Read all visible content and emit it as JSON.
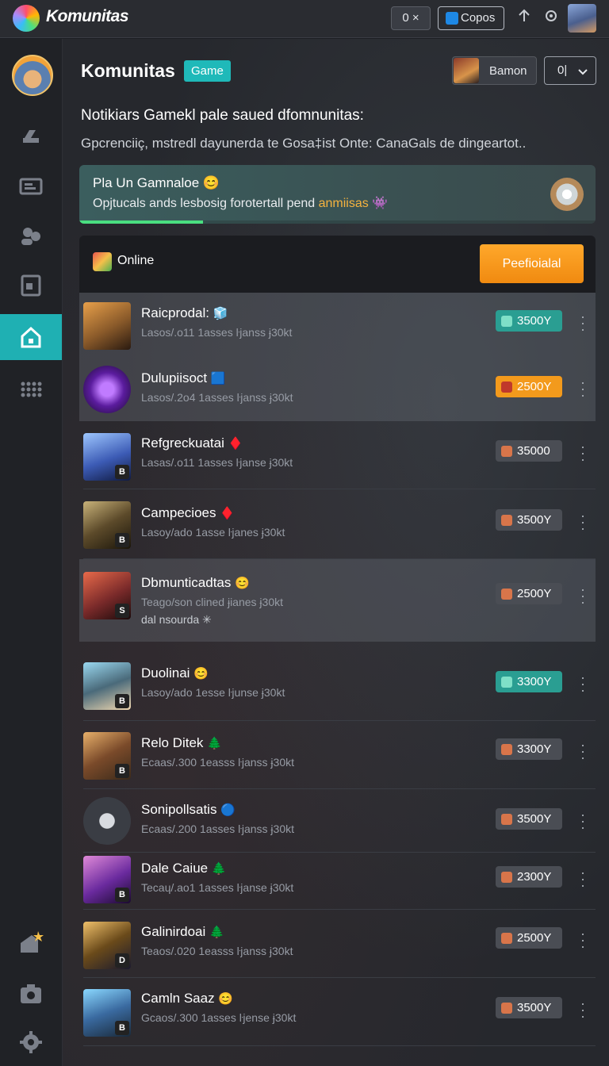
{
  "app": {
    "title": "Komunitas"
  },
  "topbar": {
    "counter_label": "0 ×",
    "copos_label": "Copos",
    "icons": [
      "logo-orb-icon",
      "copos-icon",
      "upload-icon",
      "settings-icon"
    ]
  },
  "sidebar": {
    "items": [
      {
        "icon": "tools-icon"
      },
      {
        "icon": "cards-icon"
      },
      {
        "icon": "users-icon"
      },
      {
        "icon": "document-icon"
      },
      {
        "icon": "home-icon",
        "active": true
      },
      {
        "icon": "grid-icon"
      },
      {
        "icon": "house-star-icon"
      },
      {
        "icon": "camera-icon"
      },
      {
        "icon": "gear-icon"
      }
    ]
  },
  "header": {
    "title": "Komunitas",
    "badge": "Game",
    "user_name": "Bamon",
    "select_value": "0|"
  },
  "intro": {
    "headline": "Notikiars Gamekl pale saued dfomnunitas:",
    "subline": "Gpcrenciiç, mstredl dayunerda te Gosa‡ist Onte: CanaGals de dingeartot.."
  },
  "promo": {
    "title": "Pla Un Gamnaloe 😊",
    "text_before": "Opjtucals ands lesbosig forotertall pend ",
    "text_highlight": "anmiisas",
    "text_after": " 👾",
    "progress": 0.24
  },
  "panel": {
    "online_label": "Online",
    "primary_button": "Peefioialal"
  },
  "colors": {
    "accent_teal": "#1fb9b9",
    "accent_orange": "#f39a1c",
    "sidebar_active": "#1fb0b3"
  },
  "items": [
    {
      "name": "Raicprodal:",
      "emoji": "🧊",
      "meta": "Lasos/.o11 1asses ŀjanss ɉ30kt",
      "price": "3500Y",
      "price_style": "teal"
    },
    {
      "name": "Dulupiisoct",
      "emoji": "🟦",
      "meta": "Lasos/.2o4 1asses ŀjanss ɉ30kt",
      "price": "2500Y",
      "price_style": "orange"
    },
    {
      "name": "Refgreckuatai",
      "emoji": "♦️",
      "meta": "Lasas/.o11 1asses ŀjanse ɉ30kt",
      "price": "35000",
      "price_style": "gray"
    },
    {
      "name": "Campecioes",
      "emoji": "♦️",
      "meta": "Lasoy/ado 1asse ŀjanes ɉ30kt",
      "price": "3500Y",
      "price_style": "gray"
    },
    {
      "name": "Dbmunticadtas",
      "emoji": "😊",
      "meta": "Teago/son clined ɉianes ɉ30kt",
      "meta2": "dal nsourda ✳",
      "price": "2500Y",
      "price_style": "gray"
    },
    {
      "name": "Duolinai",
      "emoji": "😊",
      "meta": "Lasoy/ado 1esse ŀjunse ɉ30kt",
      "price": "3300Y",
      "price_style": "teal"
    },
    {
      "name": "Relo Ditek",
      "emoji": "🌲",
      "meta": "Ecaas/.300 1easss ŀjanss ɉ30kt",
      "price": "3300Y",
      "price_style": "gray"
    },
    {
      "name": "Sonipollsatis",
      "emoji": "🔵",
      "meta": "Ecaas/.200 1asses ŀjanss ɉ30kt",
      "price": "3500Y",
      "price_style": "gray"
    },
    {
      "name": "Dale Caiue",
      "emoji": "🌲",
      "meta": "Tecaɥ/.ao1 1asses ŀjanse ɉ30kt",
      "price": "2300Y",
      "price_style": "gray"
    },
    {
      "name": "Galinirdoai",
      "emoji": "🌲",
      "meta": "Teaos/.020 1easss ŀjanss ɉ30kt",
      "price": "2500Y",
      "price_style": "gray"
    },
    {
      "name": "Camln Saaz",
      "emoji": "😊",
      "meta": "Gcaos/.300 1asses ŀjense ɉ30kt",
      "price": "3500Y",
      "price_style": "gray"
    }
  ]
}
